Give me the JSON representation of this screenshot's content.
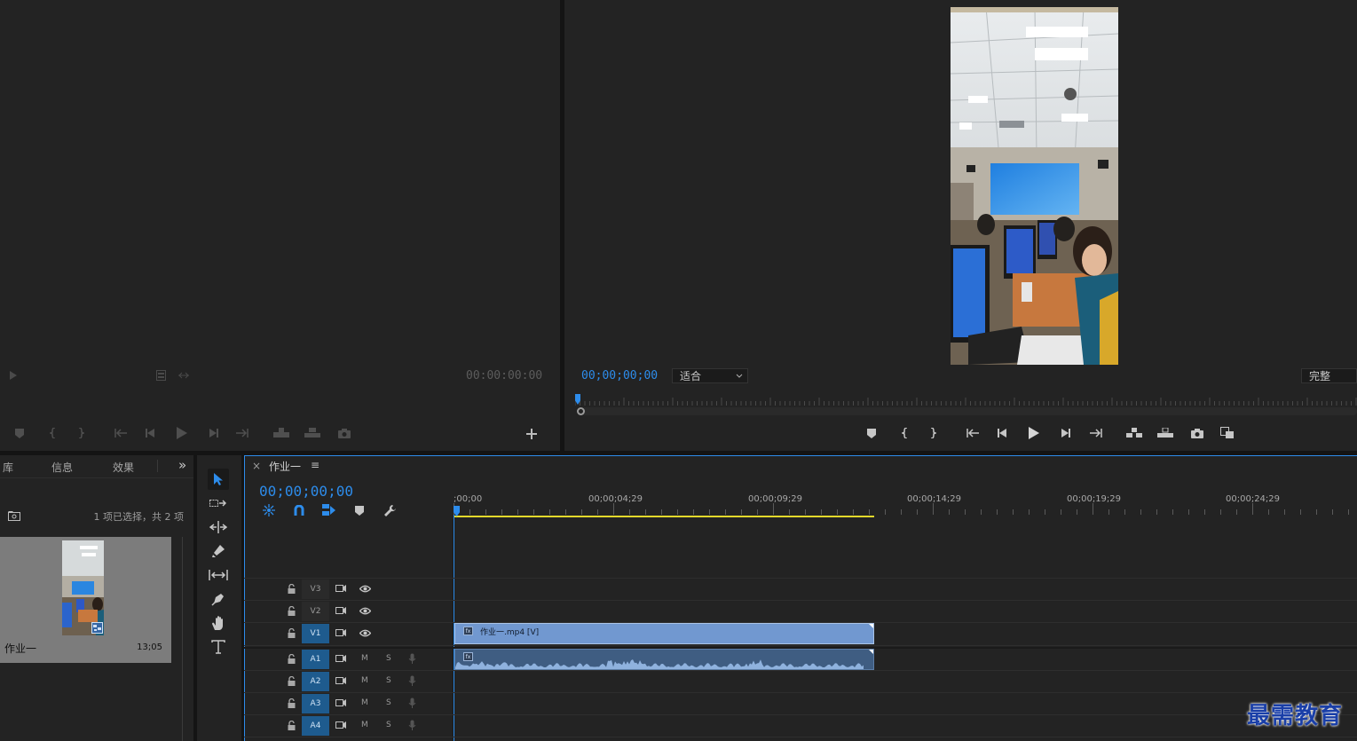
{
  "source_monitor": {
    "timecode": "00:00:00:00"
  },
  "program_monitor": {
    "timecode": "00;00;00;00",
    "fit_select": "适合",
    "quality_select": "完整"
  },
  "project_panel": {
    "tabs": [
      "库",
      "信息",
      "效果"
    ],
    "overflow": "»",
    "selection_status": "1 项已选择，共 2 项",
    "item_name": "作业一",
    "item_duration": "13;05"
  },
  "timeline": {
    "tab_title": "作业一",
    "close": "×",
    "menu": "≡",
    "timecode": "00;00;00;00",
    "ruler_labels": [
      ";00;00",
      "00;00;04;29",
      "00;00;09;29",
      "00;00;14;29",
      "00;00;19;29",
      "00;00;24;29"
    ],
    "video_tracks": [
      "V3",
      "V2",
      "V1"
    ],
    "audio_tracks": [
      "A1",
      "A2",
      "A3",
      "A4"
    ],
    "mute_label": "M",
    "solo_label": "S",
    "video_clip_label": "作业一.mp4 [V]",
    "fx_badge": "fx",
    "accent": "#2d8ceb",
    "clip_color": "#7198d0"
  },
  "tools": [
    "selection-tool",
    "track-select-tool",
    "ripple-edit-tool",
    "razor-tool",
    "slip-tool",
    "pen-tool",
    "hand-tool",
    "type-tool"
  ],
  "watermark": "最需教育"
}
